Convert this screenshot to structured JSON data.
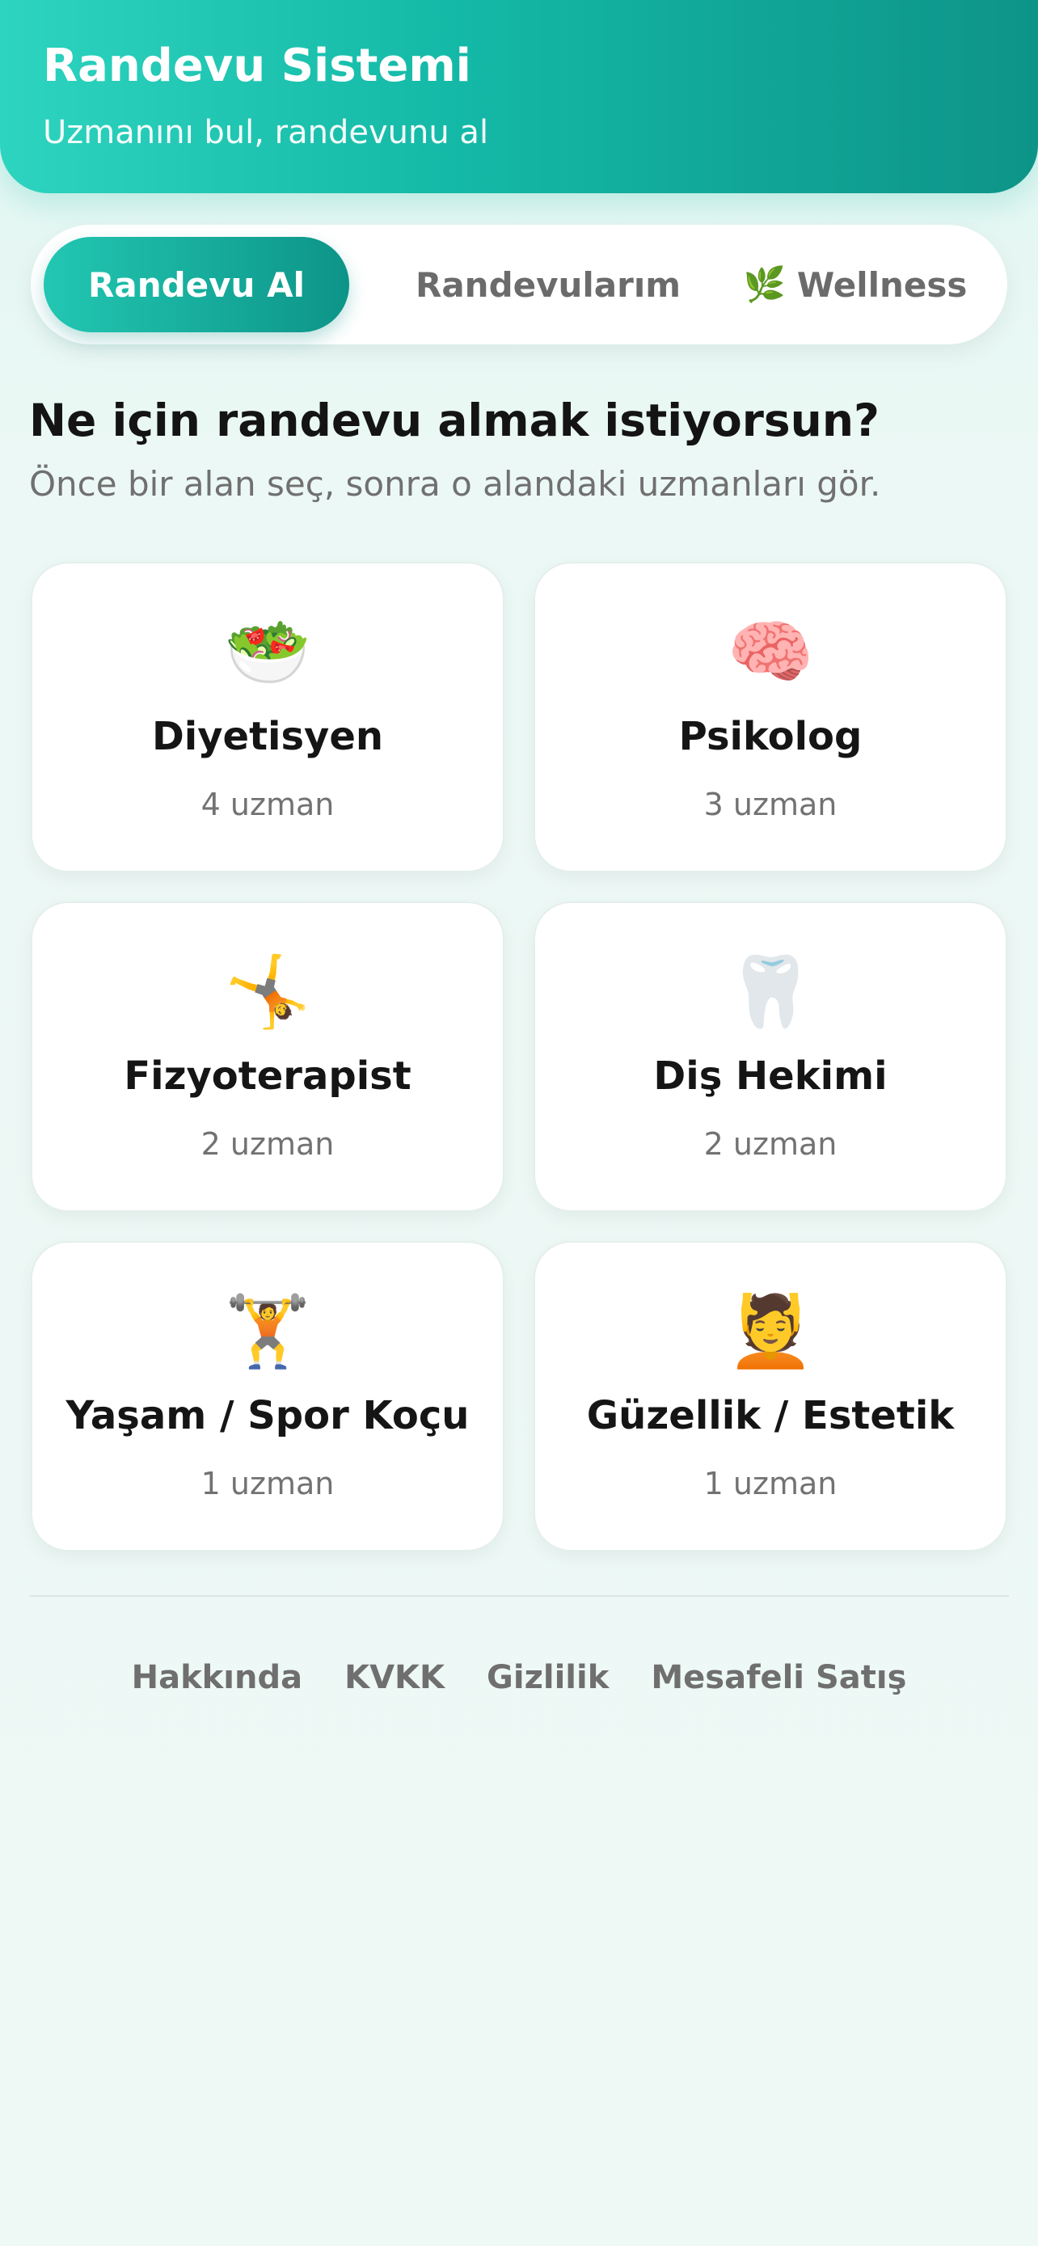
{
  "header": {
    "title": "Randevu Sistemi",
    "subtitle": "Uzmanını bul, randevunu al"
  },
  "tabs": [
    {
      "label": "Randevu Al",
      "active": true
    },
    {
      "label": "Randevularım",
      "active": false
    },
    {
      "label": "Wellness",
      "icon": "🌿",
      "icon_name": "leaf-icon",
      "active": false
    }
  ],
  "main": {
    "title": "Ne için randevu almak istiyorsun?",
    "subtitle": "Önce bir alan seç, sonra o alandaki uzmanları gör."
  },
  "categories": [
    {
      "emoji": "🥗",
      "icon_name": "salad-icon",
      "name": "Diyetisyen",
      "count": "4 uzman"
    },
    {
      "emoji": "🧠",
      "icon_name": "brain-icon",
      "name": "Psikolog",
      "count": "3 uzman"
    },
    {
      "emoji": "🤸",
      "icon_name": "cartwheel-icon",
      "name": "Fizyoterapist",
      "count": "2 uzman"
    },
    {
      "emoji": "🦷",
      "icon_name": "tooth-icon",
      "name": "Diş Hekimi",
      "count": "2 uzman"
    },
    {
      "emoji": "🏋️",
      "icon_name": "weightlifter-icon",
      "name": "Yaşam / Spor Koçu",
      "count": "1 uzman"
    },
    {
      "emoji": "💆",
      "icon_name": "massage-icon",
      "name": "Güzellik / Estetik",
      "count": "1 uzman"
    }
  ],
  "footer": {
    "links": [
      "Hakkında",
      "KVKK",
      "Gizlilik",
      "Mesafeli Satış"
    ]
  },
  "colors": {
    "accent": "#14b8a6",
    "accent_dark": "#0d9488",
    "background": "#eef9f6"
  }
}
